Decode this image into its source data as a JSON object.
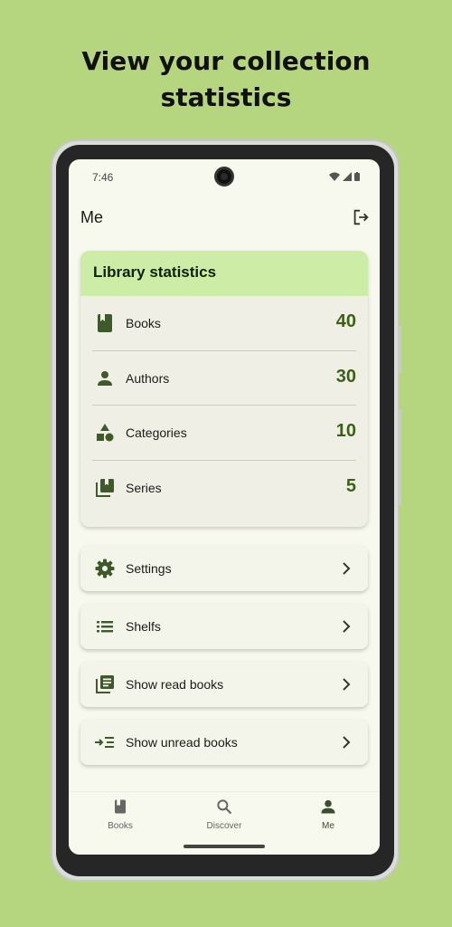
{
  "headline": {
    "line1": "View your collection",
    "line2": "statistics"
  },
  "status_bar": {
    "time": "7:46"
  },
  "app_bar": {
    "title": "Me",
    "action_icon": "logout-icon"
  },
  "stats": {
    "title": "Library statistics",
    "rows": [
      {
        "label": "Books",
        "value": "40",
        "icon": "book-icon"
      },
      {
        "label": "Authors",
        "value": "30",
        "icon": "person-icon"
      },
      {
        "label": "Categories",
        "value": "10",
        "icon": "category-icon"
      },
      {
        "label": "Series",
        "value": "5",
        "icon": "library-books-icon"
      }
    ]
  },
  "menu": [
    {
      "label": "Settings",
      "icon": "gear-icon"
    },
    {
      "label": "Shelfs",
      "icon": "list-icon"
    },
    {
      "label": "Show read books",
      "icon": "read-books-icon"
    },
    {
      "label": "Show unread books",
      "icon": "unread-books-icon"
    }
  ],
  "bottom_nav": {
    "items": [
      {
        "label": "Books",
        "icon": "book-icon"
      },
      {
        "label": "Discover",
        "icon": "search-icon"
      },
      {
        "label": "Me",
        "icon": "person-icon",
        "active": true
      }
    ]
  },
  "colors": {
    "background": "#b5d67f",
    "stats_header": "#cdeda6",
    "accent": "#3b6118",
    "icon": "#3f5a2a"
  }
}
